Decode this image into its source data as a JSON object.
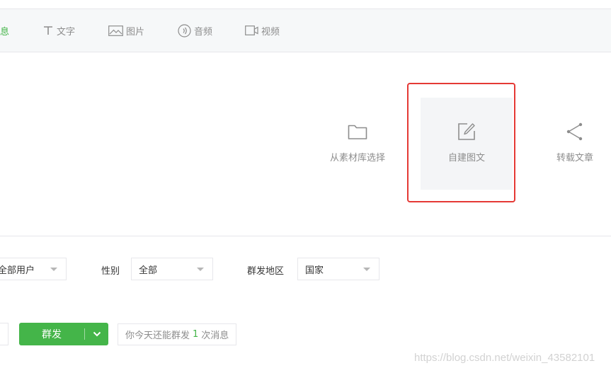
{
  "tabs": [
    {
      "label": "息",
      "icon": "none"
    },
    {
      "label": "文字",
      "icon": "text-icon"
    },
    {
      "label": "图片",
      "icon": "image-icon"
    },
    {
      "label": "音频",
      "icon": "audio-icon"
    },
    {
      "label": "视频",
      "icon": "video-icon"
    }
  ],
  "actions": {
    "library": {
      "label": "从素材库选择",
      "icon": "folder-icon"
    },
    "create": {
      "label": "自建图文",
      "icon": "edit-icon"
    },
    "share": {
      "label": "转载文章",
      "icon": "share-icon"
    }
  },
  "filters": {
    "group_value": "全部用户",
    "gender_label": "性别",
    "gender_value": "全部",
    "region_label": "群发地区",
    "region_value": "国家"
  },
  "send": {
    "button_label": "群发",
    "tip_prefix": "你今天还能群发",
    "tip_count": "1",
    "tip_suffix": "次消息"
  },
  "watermark": "https://blog.csdn.net/weixin_43582101",
  "colors": {
    "accent": "#44b549",
    "highlight": "#e53935",
    "muted": "#8d8d8d"
  }
}
